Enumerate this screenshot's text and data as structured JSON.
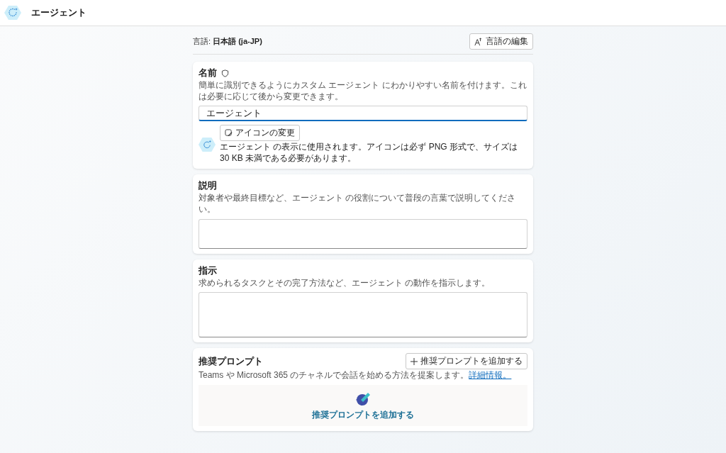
{
  "header": {
    "title": "エージェント"
  },
  "language": {
    "label": "言語: **日本語 (ja-JP)**",
    "edit_button": "言語の編集"
  },
  "name_card": {
    "title": "名前",
    "description": "簡単に識別できるようにカスタム エージェント にわかりやすい名前を付けます。これは必要に応じて後から変更できます。",
    "value": "エージェント",
    "change_icon_button": "アイコンの変更",
    "icon_note": "エージェント の表示に使用されます。アイコンは必ず PNG 形式で、サイズは 30 KB 未満である必要があります。"
  },
  "description_card": {
    "title": "説明",
    "description": "対象者や最終目標など、エージェント の役割について普段の言葉で説明してください。"
  },
  "instructions_card": {
    "title": "指示",
    "description": "求められるタスクとその完了方法など、エージェント の動作を指示します。"
  },
  "prompts_card": {
    "title": "推奨プロンプト",
    "description": "Teams や Microsoft 365 のチャネルで会話を始める方法を提案します。",
    "link": "詳細情報。",
    "add_button": "推奨プロンプトを追加する",
    "empty_action": "推奨プロンプトを追加する"
  }
}
